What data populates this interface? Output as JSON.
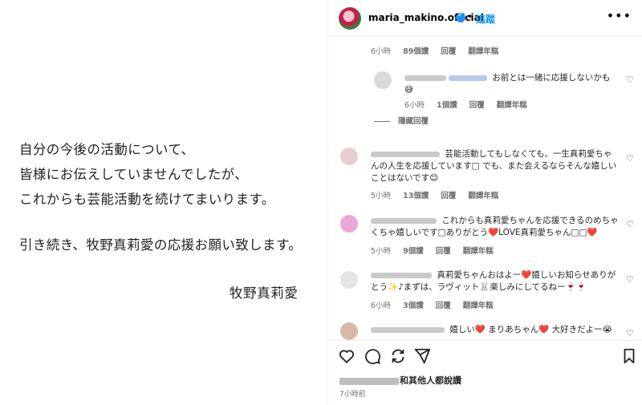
{
  "post_image": {
    "lines": [
      "自分の今後の活動について、",
      "皆様にお伝えしていませんでしたが、",
      "これからも芸能活動を続けてまいります。",
      "引き続き、牧野真莉愛の応援お願い致します。"
    ],
    "signature": "牧野真莉愛"
  },
  "header": {
    "username": "maria_makino.official",
    "dot": "•",
    "follow_label": "追蹤",
    "more_label": "•••"
  },
  "first_meta": {
    "time": "6小時",
    "likes": "89個讚",
    "reply": "回覆",
    "translate": "翻譯年糕"
  },
  "reply": {
    "text": "お前とは一緒に応援しないかも 😅",
    "meta": {
      "time": "6小時",
      "likes": "1個讚",
      "reply": "回覆",
      "translate": "翻譯年糕"
    }
  },
  "hide_replies_label": "隱藏回覆",
  "comments": [
    {
      "text": "芸能活動してもしなくても、一生真莉愛ちゃんの人生を応援しています□ でも、また会えるならそんな嬉しいことはないです😊",
      "meta": {
        "time": "5小時",
        "likes": "13個讚",
        "reply": "回覆",
        "translate": "翻譯年糕"
      }
    },
    {
      "text": "これからも真莉愛ちゃんを応援できるのめちゃくちゃ嬉しいです□ありがとう❤️LOVE真莉愛ちゃん□□❤️",
      "meta": {
        "time": "5小時",
        "likes": "9個讚",
        "reply": "回覆",
        "translate": "翻譯年糕"
      }
    },
    {
      "text": "真莉愛ちゃんおはよー❤️嬉しいお知らせありがとう✨♪まずは、ラヴィット🐰楽しみにしてるねー🍷🍷",
      "meta": {
        "time": "6小時",
        "likes": "3個讚",
        "reply": "回覆",
        "translate": "翻譯年糕"
      }
    },
    {
      "text": "嬉しい❤️ まりあちゃん❤️ 大好きだよー😭"
    }
  ],
  "likes_text": "和其他人都說讚",
  "post_time": "7小時前",
  "colors": {
    "accent": "#0095f6",
    "verified": "#1a91ef",
    "heart": "#e0223a"
  },
  "icons": [
    "heart-icon",
    "comment-icon",
    "share-icon",
    "send-icon",
    "bookmark-icon",
    "verified-icon",
    "more-icon"
  ]
}
